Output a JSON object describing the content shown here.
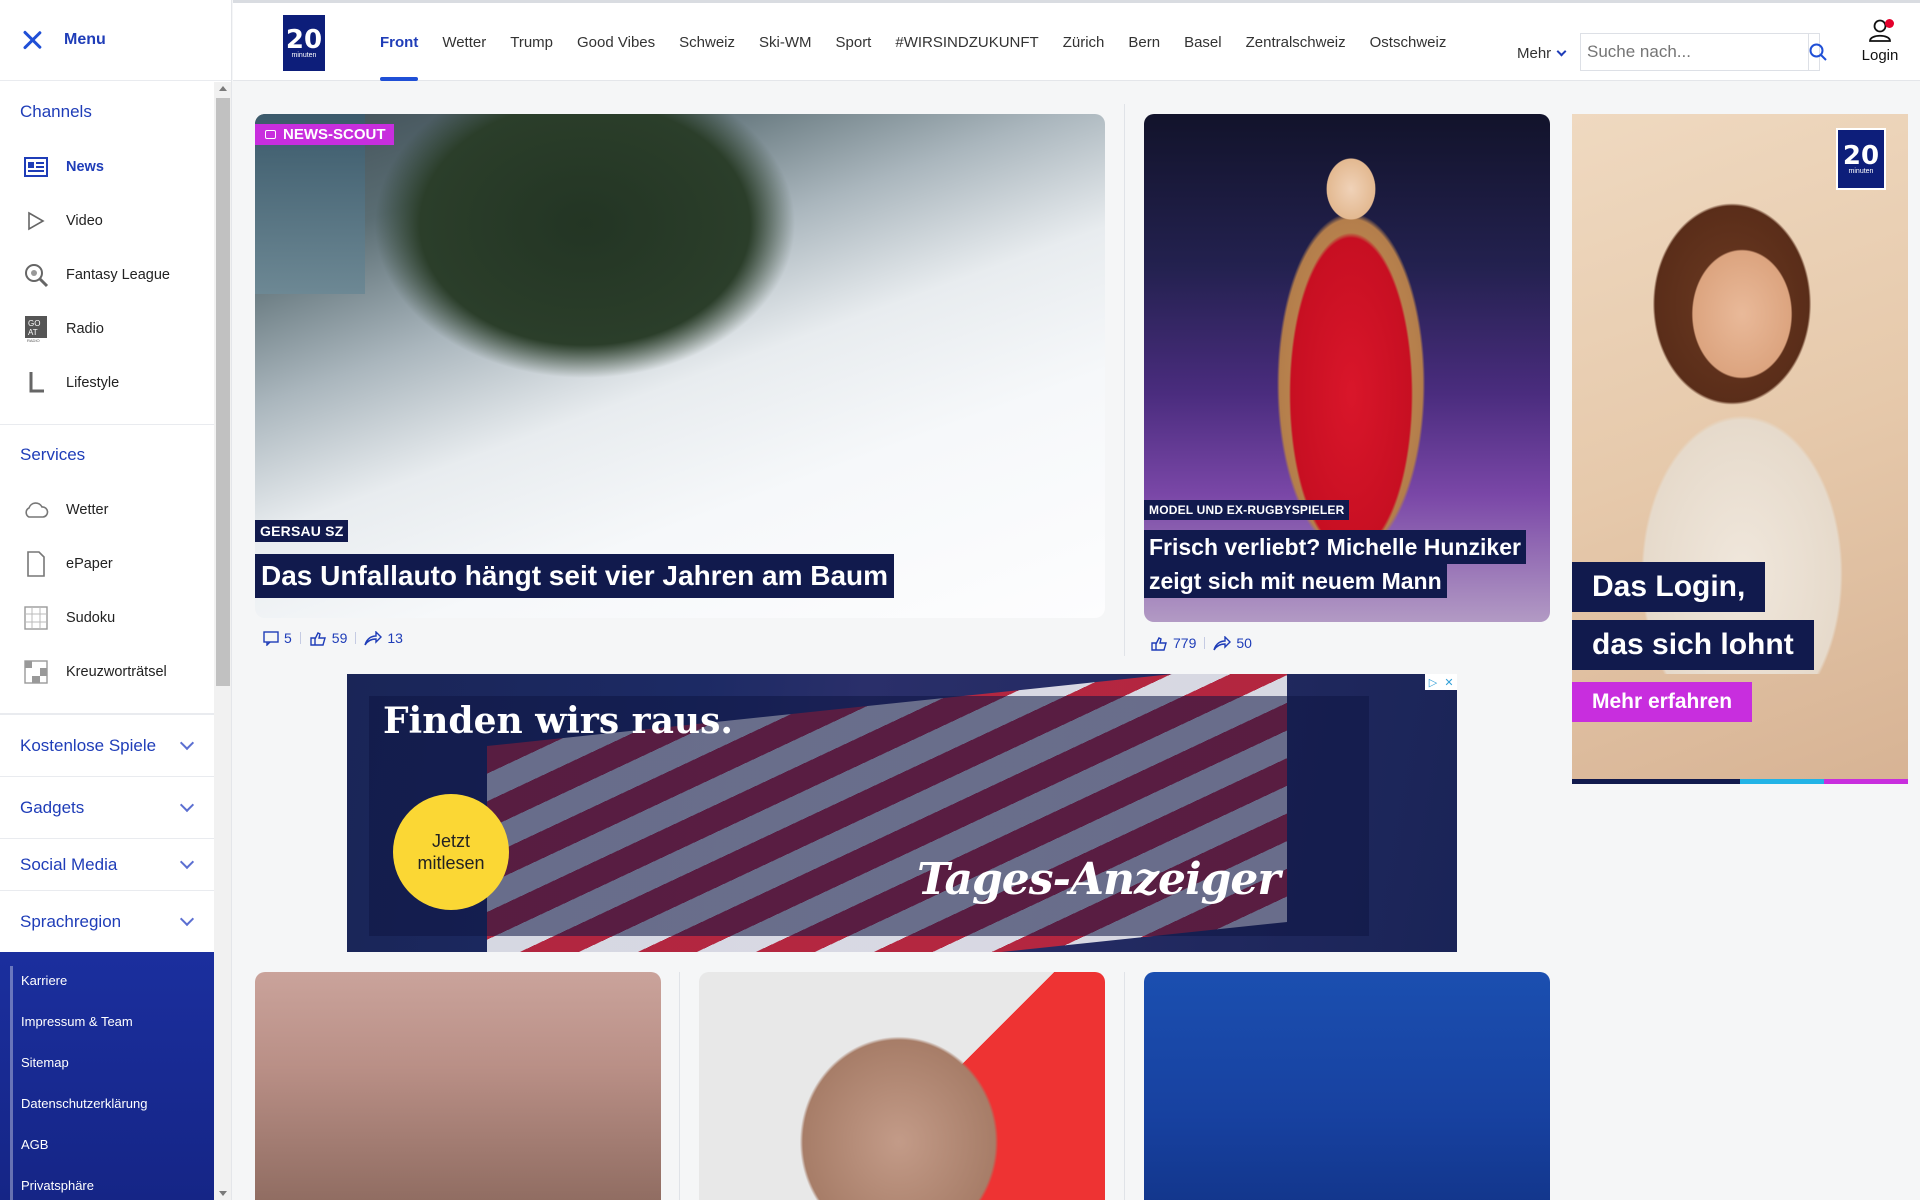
{
  "sidebar": {
    "menu_label": "Menu",
    "channels_title": "Channels",
    "channels": [
      {
        "label": "News",
        "icon": "newspaper-icon",
        "active": true
      },
      {
        "label": "Video",
        "icon": "play-icon"
      },
      {
        "label": "Fantasy League",
        "icon": "fantasy-league-icon"
      },
      {
        "label": "Radio",
        "icon": "radio-icon"
      },
      {
        "label": "Lifestyle",
        "icon": "lifestyle-icon"
      }
    ],
    "services_title": "Services",
    "services": [
      {
        "label": "Wetter",
        "icon": "cloud-icon"
      },
      {
        "label": "ePaper",
        "icon": "page-icon"
      },
      {
        "label": "Sudoku",
        "icon": "sudoku-icon"
      },
      {
        "label": "Kreuzworträtsel",
        "icon": "crossword-icon"
      }
    ],
    "collapsibles": [
      "Kostenlose Spiele",
      "Gadgets",
      "Social Media",
      "Sprachregion"
    ],
    "footer_links": [
      "Karriere",
      "Impressum & Team",
      "Sitemap",
      "Datenschutzerklärung",
      "AGB",
      "Privatsphäre"
    ]
  },
  "header": {
    "logo_number": "20",
    "logo_text": "minuten",
    "nav": [
      "Front",
      "Wetter",
      "Trump",
      "Good Vibes",
      "Schweiz",
      "Ski-WM",
      "Sport",
      "#WIRSINDZUKUNFT",
      "Zürich",
      "Bern",
      "Basel",
      "Zentralschweiz",
      "Ostschweiz"
    ],
    "active_nav": "Front",
    "more_label": "Mehr",
    "search_placeholder": "Suche nach...",
    "login_label": "Login"
  },
  "articles": {
    "main": {
      "badge": "NEWS-SCOUT",
      "location": "GERSAU SZ",
      "headline": "Das Unfallauto hängt seit vier Jahren am Baum",
      "comments": "5",
      "reactions": "59",
      "shares": "13"
    },
    "second": {
      "kicker": "MODEL UND EX-RUGBYSPIELER",
      "headline_line1": "Frisch verliebt? Michelle Hunziker",
      "headline_line2": "zeigt sich mit neuem Mann",
      "reactions": "779",
      "shares": "50"
    }
  },
  "ads": {
    "right": {
      "logo_number": "20",
      "logo_text": "minuten",
      "line1": "Das Login,",
      "line2": "das sich lohnt",
      "cta": "Mehr erfahren"
    },
    "banner": {
      "headline": "Finden wirs raus.",
      "cta_line1": "Jetzt",
      "cta_line2": "mitlesen",
      "brand": "Tages-Anzeiger"
    }
  },
  "colors": {
    "brand_blue": "#1f3db8",
    "navy": "#111a4d",
    "scout_magenta": "#c82ede",
    "cta_yellow": "#fbd734"
  }
}
